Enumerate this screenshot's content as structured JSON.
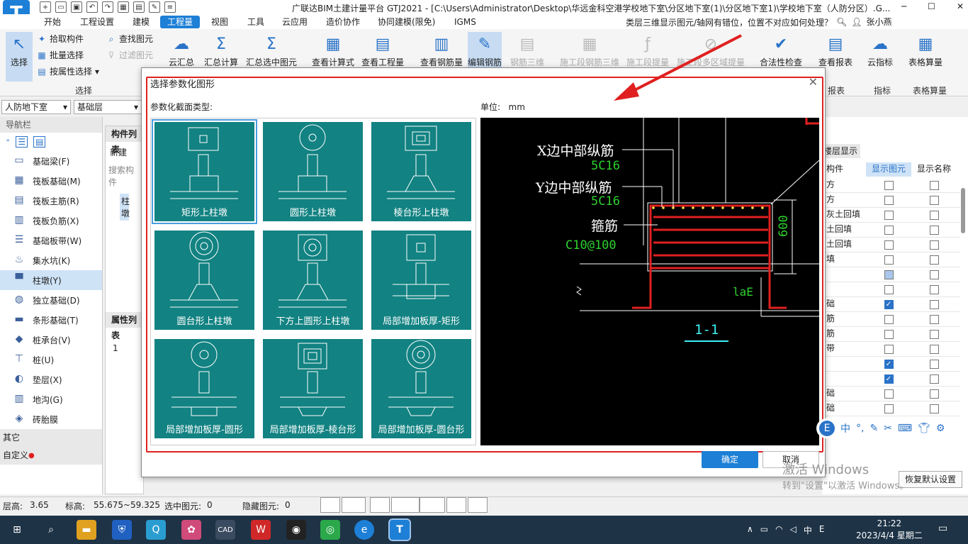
{
  "app": {
    "logo_glyph": "T",
    "window_title": "广联达BIM土建计量平台 GTJ2021 - [C:\\Users\\Administrator\\Desktop\\华远金科空港学校地下室\\分区地下室(1)\\分区地下室1)\\学校地下室（人防分区）.G...",
    "win_min": "─",
    "win_max": "☐",
    "win_close": "✕"
  },
  "menu": {
    "items": [
      "开始",
      "工程设置",
      "建模",
      "工程量",
      "视图",
      "工具",
      "云应用",
      "造价协作",
      "协同建模(限免)",
      "IGMS"
    ],
    "active_index": 3,
    "help_question": "类层三维显示图元/轴网有错位，位置不对应如何处理？",
    "user_name": "张小燕"
  },
  "ribbon": {
    "select": {
      "label": "选择",
      "pick": "拾取构件",
      "batch": "批量选择",
      "by_attr": "按属性选择",
      "find": "查找图元",
      "filter": "过滤图元",
      "group": "选择"
    },
    "buttons": [
      "云汇总",
      "汇总计算",
      "汇总选中图元",
      "查看计算式",
      "查看工程量",
      "查看钢筋量",
      "编辑钢筋",
      "钢筋三维",
      "施工段钢筋三维",
      "施工段提量",
      "施工段多区域提量",
      "合法性检查",
      "查看报表",
      "云指标",
      "表格算量"
    ],
    "groups": [
      "报表",
      "指标",
      "表格算量"
    ]
  },
  "dropdowns": {
    "floor": "人防地下室",
    "layer": "基础层"
  },
  "nav": {
    "header": "导航栏",
    "items": [
      "基础梁(F)",
      "筏板基础(M)",
      "筏板主筋(R)",
      "筏板负筋(X)",
      "基础板带(W)",
      "集水坑(K)",
      "柱墩(Y)",
      "独立基础(D)",
      "条形基础(T)",
      "桩承台(V)",
      "桩(U)",
      "垫层(X)",
      "地沟(G)",
      "砖胎膜"
    ],
    "selected_index": 6,
    "section_other": "其它",
    "section_custom": "自定义"
  },
  "component_panel": {
    "title": "构件列表",
    "new_label": "新建",
    "search": "搜索构件",
    "item": "柱墩",
    "attr_title": "属性列表",
    "row1": "1"
  },
  "right_panel": {
    "tab": "楼层显示",
    "col_show": "显示图元",
    "col_name": "显示名称",
    "col_first": "构件",
    "rows": [
      {
        "name": "方",
        "a": "off",
        "b": "off"
      },
      {
        "name": "方",
        "a": "off",
        "b": "off"
      },
      {
        "name": "灰土回填",
        "a": "off",
        "b": "off"
      },
      {
        "name": "土回填",
        "a": "off",
        "b": "off"
      },
      {
        "name": "土回填",
        "a": "off",
        "b": "off"
      },
      {
        "name": "填",
        "a": "off",
        "b": "off"
      },
      {
        "name": "",
        "a": "half",
        "b": "off"
      },
      {
        "name": "",
        "a": "off",
        "b": "off"
      },
      {
        "name": "础",
        "a": "on",
        "b": "off"
      },
      {
        "name": "筋",
        "a": "off",
        "b": "off"
      },
      {
        "name": "筋",
        "a": "off",
        "b": "off"
      },
      {
        "name": "带",
        "a": "off",
        "b": "off"
      },
      {
        "name": "",
        "a": "on",
        "b": "off"
      },
      {
        "name": "",
        "a": "on",
        "b": "off"
      },
      {
        "name": "础",
        "a": "off",
        "b": "off"
      },
      {
        "name": "础",
        "a": "off",
        "b": "off"
      }
    ],
    "restore": "恢复默认设置"
  },
  "dialog": {
    "title": "选择参数化图形",
    "section_label": "参数化截面类型:",
    "unit_label": "单位:",
    "unit_value": "mm",
    "tiles": [
      "矩形上柱墩",
      "圆形上柱墩",
      "棱台形上柱墩",
      "圆台形上柱墩",
      "下方上圆形上柱墩",
      "局部增加板厚-矩形",
      "局部增加板厚-圆形",
      "局部增加板厚-棱台形",
      "局部增加板厚-圆台形"
    ],
    "selected_tile": 0,
    "ok": "确定",
    "cancel": "取消",
    "preview": {
      "x_label": "X边中部纵筋",
      "x_value": "5C16",
      "y_label": "Y边中部纵筋",
      "y_value": "5C16",
      "stirrup_label": "箍筋",
      "stirrup_value": "C10@100",
      "dim_value": "600",
      "anchor": "laE",
      "section_name": "1-1"
    }
  },
  "status": {
    "floor_height_label": "层高:",
    "floor_height": "3.65",
    "elevation_label": "标高:",
    "elevation": "55.675~59.325",
    "selected_label": "选中图元:",
    "selected": "0",
    "hidden_label": "隐藏图元:",
    "hidden": "0"
  },
  "taskbar": {
    "time": "21:22",
    "date": "2023/4/4 星期二",
    "ime": "中",
    "activate_line1": "激活 Windows",
    "activate_line2": "转到\"设置\"以激活 Windows。"
  },
  "colors": {
    "accent": "#1d7fd6",
    "tile_bg": "#128282",
    "annotation_red": "#e02020",
    "preview_bg": "#000000",
    "rebar_red": "#e02020",
    "label_green": "#2ed12e"
  }
}
